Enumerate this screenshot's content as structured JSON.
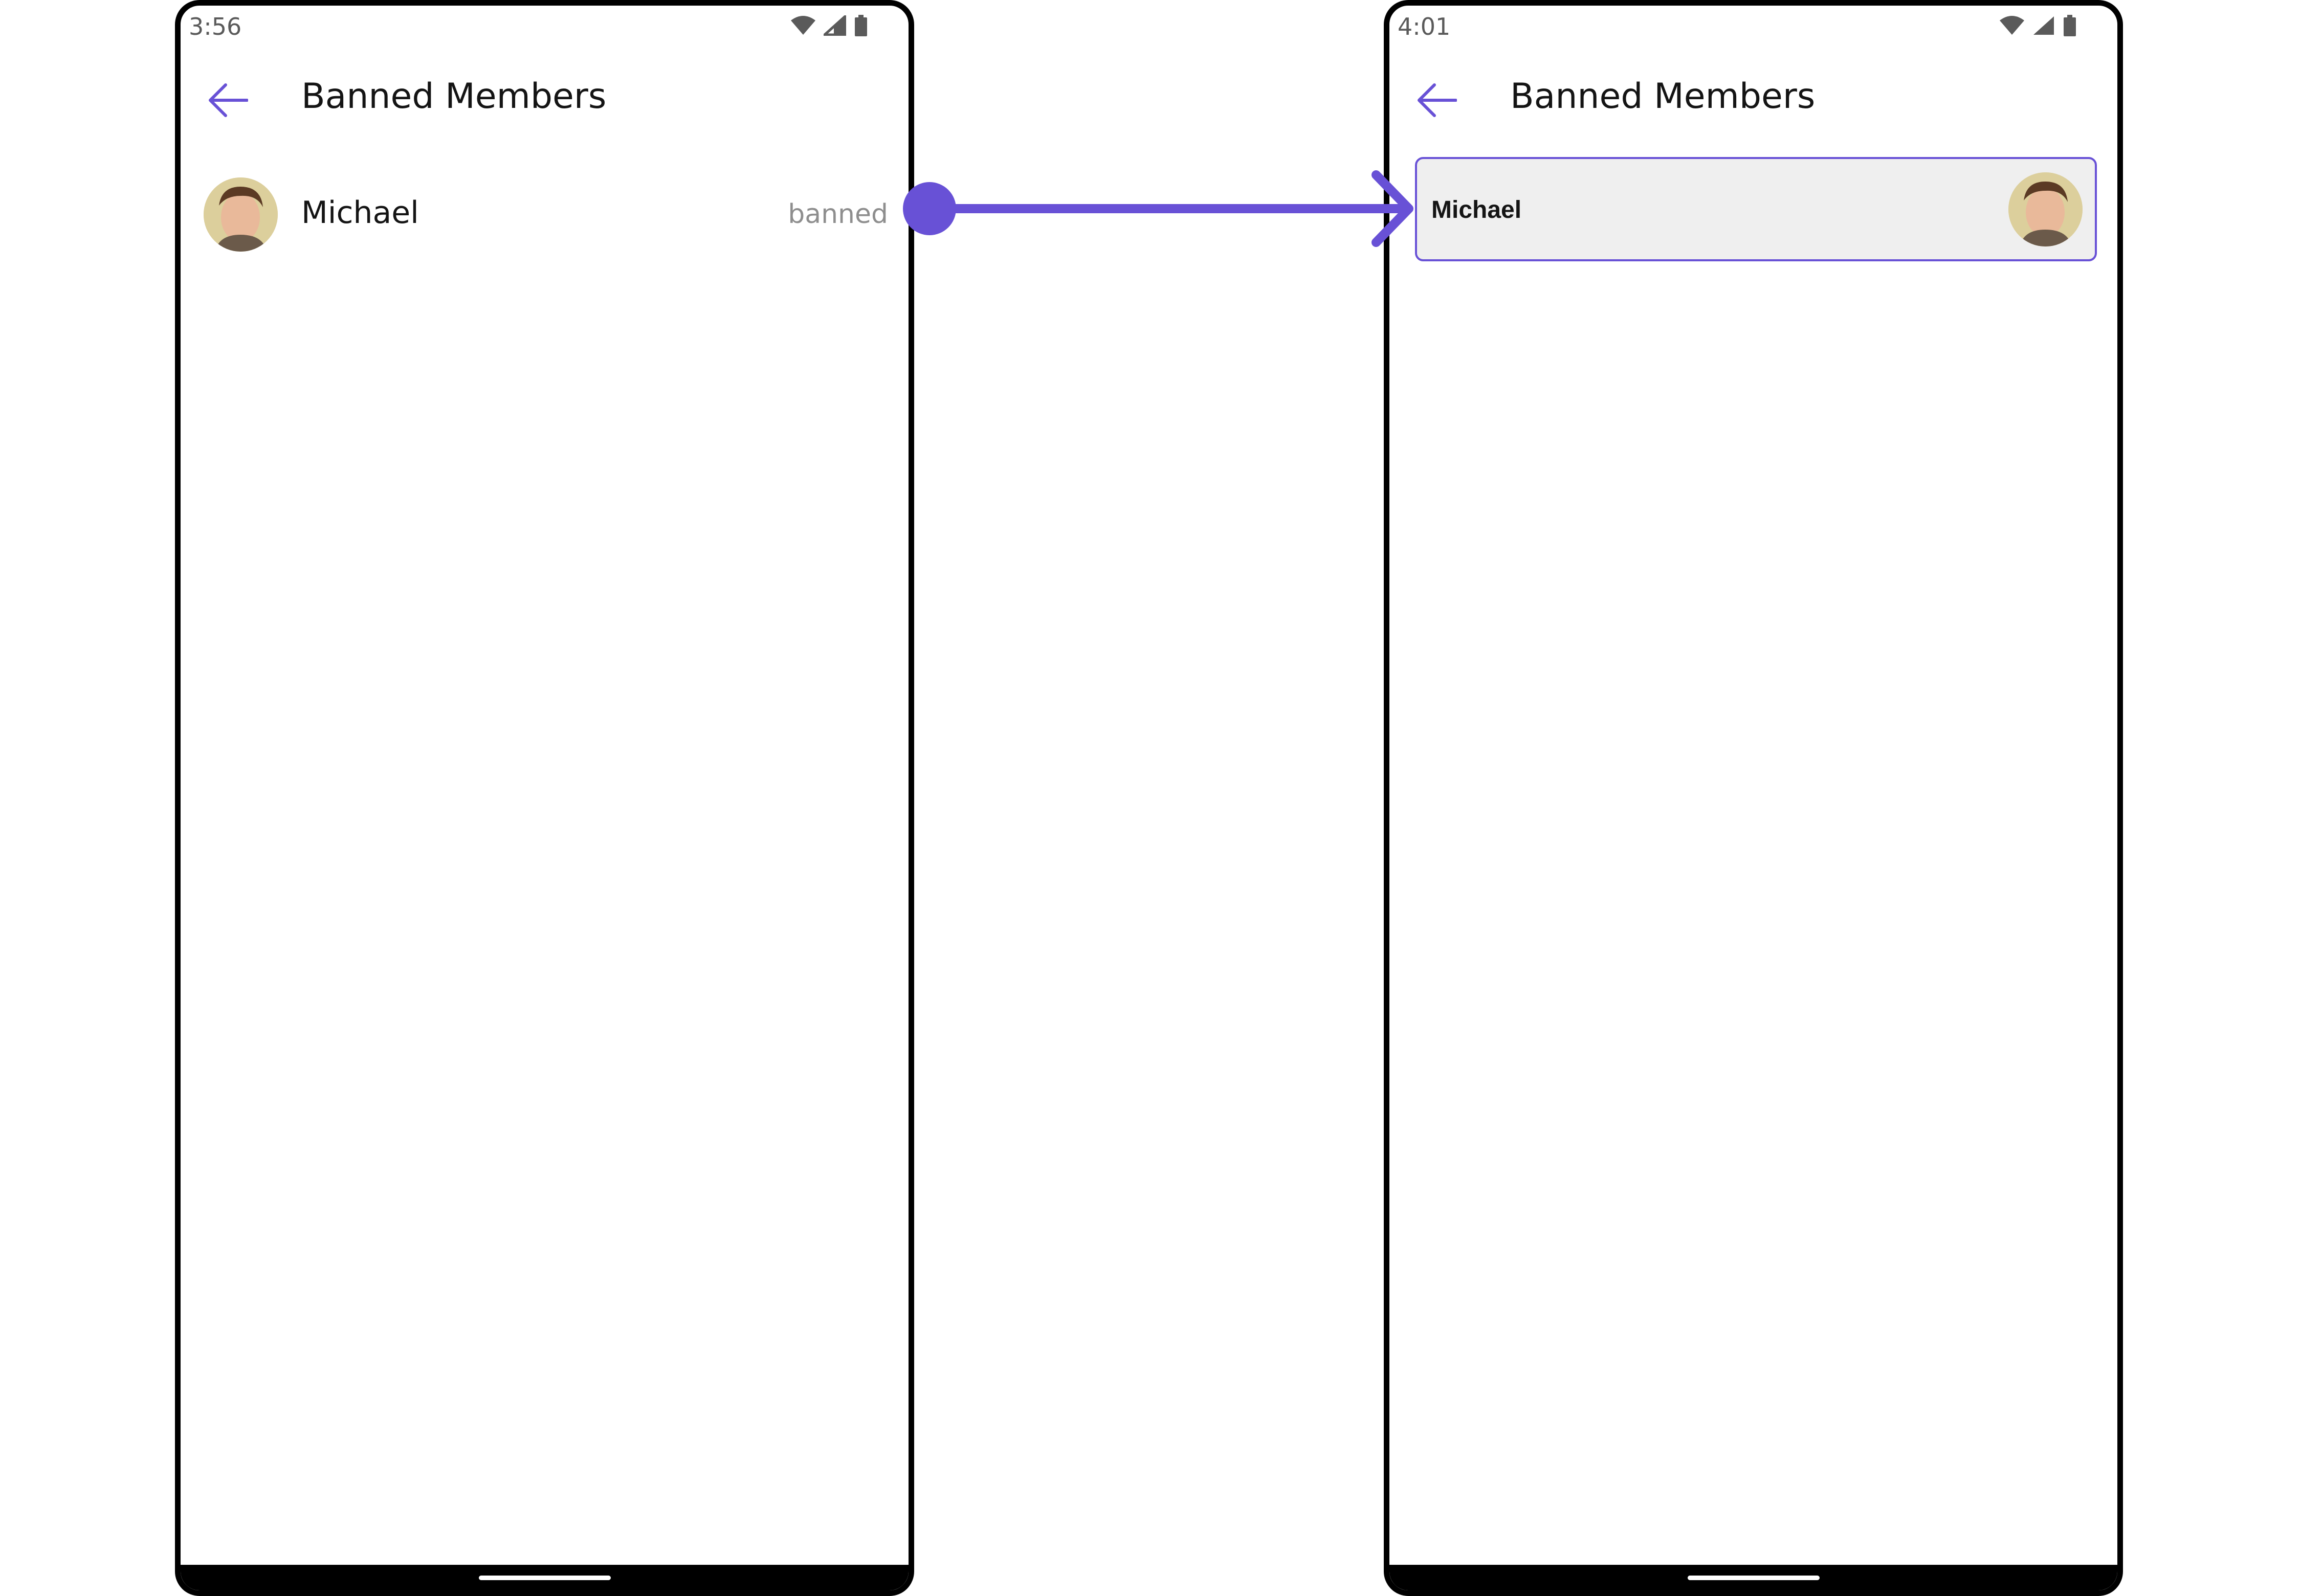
{
  "accent_color": "#6851d6",
  "left_screen": {
    "status_time": "3:56",
    "title": "Banned Members",
    "member": {
      "name": "Michael",
      "tail_text": "banned"
    }
  },
  "right_screen": {
    "status_time": "4:01",
    "title": "Banned Members",
    "member": {
      "name": "Michael"
    }
  },
  "icons": {
    "back": "arrow-left-icon",
    "wifi": "wifi-icon",
    "signal": "cellular-signal-icon",
    "battery": "battery-icon"
  }
}
